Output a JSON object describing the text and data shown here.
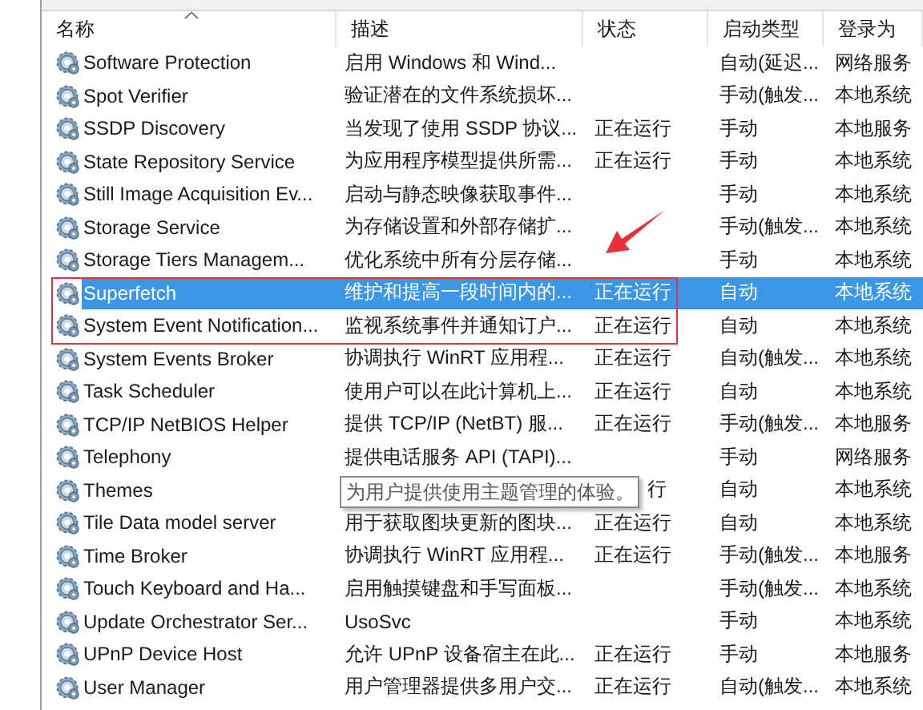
{
  "table": {
    "columns": [
      {
        "label": "名称",
        "sorted": true
      },
      {
        "label": "描述",
        "sorted": false
      },
      {
        "label": "状态",
        "sorted": false
      },
      {
        "label": "启动类型",
        "sorted": false
      },
      {
        "label": "登录为",
        "sorted": false
      }
    ],
    "rows": [
      {
        "name": "Software Protection",
        "description": "启用 Windows 和 Wind...",
        "status": "",
        "startup": "自动(延迟...",
        "logon": "网络服务",
        "selected": false
      },
      {
        "name": "Spot Verifier",
        "description": "验证潜在的文件系统损坏...",
        "status": "",
        "startup": "手动(触发...",
        "logon": "本地系统",
        "selected": false
      },
      {
        "name": "SSDP Discovery",
        "description": "当发现了使用 SSDP 协议...",
        "status": "正在运行",
        "startup": "手动",
        "logon": "本地服务",
        "selected": false
      },
      {
        "name": "State Repository Service",
        "description": "为应用程序模型提供所需...",
        "status": "正在运行",
        "startup": "手动",
        "logon": "本地系统",
        "selected": false
      },
      {
        "name": "Still Image Acquisition Ev...",
        "description": "启动与静态映像获取事件...",
        "status": "",
        "startup": "手动",
        "logon": "本地系统",
        "selected": false
      },
      {
        "name": "Storage Service",
        "description": "为存储设置和外部存储扩...",
        "status": "",
        "startup": "手动(触发...",
        "logon": "本地系统",
        "selected": false
      },
      {
        "name": "Storage Tiers Managem...",
        "description": "优化系统中所有分层存储...",
        "status": "",
        "startup": "手动",
        "logon": "本地系统",
        "selected": false
      },
      {
        "name": "Superfetch",
        "description": "维护和提高一段时间内的...",
        "status": "正在运行",
        "startup": "自动",
        "logon": "本地系统",
        "selected": true
      },
      {
        "name": "System Event Notification...",
        "description": "监视系统事件并通知订户...",
        "status": "正在运行",
        "startup": "自动",
        "logon": "本地系统",
        "selected": false
      },
      {
        "name": "System Events Broker",
        "description": "协调执行 WinRT 应用程...",
        "status": "正在运行",
        "startup": "自动(触发...",
        "logon": "本地系统",
        "selected": false
      },
      {
        "name": "Task Scheduler",
        "description": "使用户可以在此计算机上...",
        "status": "正在运行",
        "startup": "自动",
        "logon": "本地系统",
        "selected": false
      },
      {
        "name": "TCP/IP NetBIOS Helper",
        "description": "提供 TCP/IP (NetBT) 服...",
        "status": "正在运行",
        "startup": "手动(触发...",
        "logon": "本地服务",
        "selected": false
      },
      {
        "name": "Telephony",
        "description": "提供电话服务 API (TAPI)...",
        "status": "",
        "startup": "手动",
        "logon": "网络服务",
        "selected": false
      },
      {
        "name": "Themes",
        "description": "",
        "status": "行",
        "startup": "自动",
        "logon": "本地系统",
        "selected": false,
        "tooltip": "为用户提供使用主题管理的体验。"
      },
      {
        "name": "Tile Data model server",
        "description": "用于获取图块更新的图块...",
        "status": "正在运行",
        "startup": "自动",
        "logon": "本地系统",
        "selected": false
      },
      {
        "name": "Time Broker",
        "description": "协调执行 WinRT 应用程...",
        "status": "正在运行",
        "startup": "手动(触发...",
        "logon": "本地服务",
        "selected": false
      },
      {
        "name": "Touch Keyboard and Ha...",
        "description": "启用触摸键盘和手写面板...",
        "status": "",
        "startup": "手动(触发...",
        "logon": "本地系统",
        "selected": false
      },
      {
        "name": "Update Orchestrator Ser...",
        "description": "UsoSvc",
        "status": "",
        "startup": "手动",
        "logon": "本地系统",
        "selected": false
      },
      {
        "name": "UPnP Device Host",
        "description": "允许 UPnP 设备宿主在此...",
        "status": "正在运行",
        "startup": "手动",
        "logon": "本地服务",
        "selected": false
      },
      {
        "name": "User Manager",
        "description": "用户管理器提供多用户交...",
        "status": "正在运行",
        "startup": "自动(触发...",
        "logon": "本地系统",
        "selected": false
      }
    ]
  }
}
